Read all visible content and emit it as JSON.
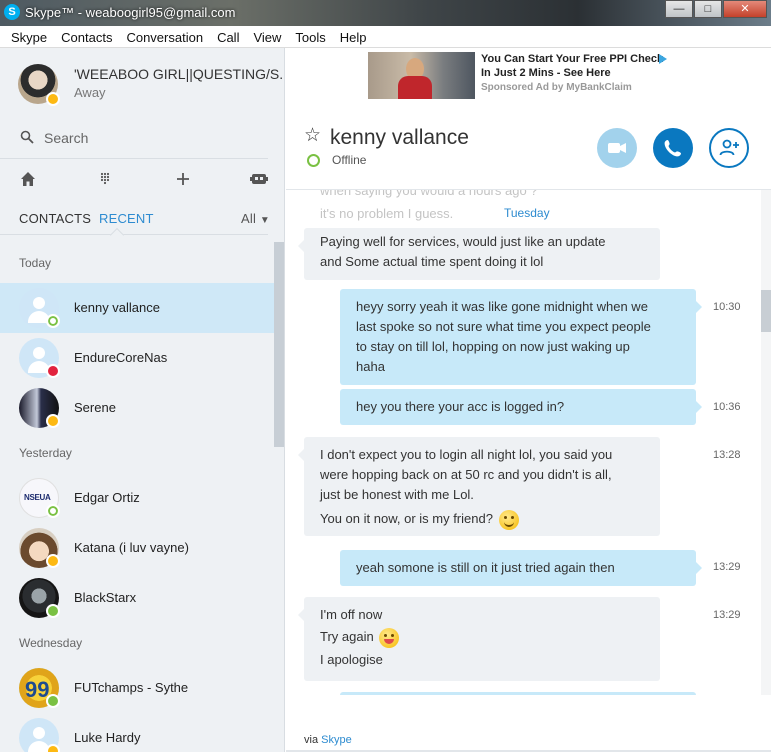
{
  "window": {
    "title": "Skype™ - weaboogirl95@gmail.com",
    "controls": [
      "minimize",
      "maximize",
      "close"
    ]
  },
  "menu": [
    "Skype",
    "Contacts",
    "Conversation",
    "Call",
    "View",
    "Tools",
    "Help"
  ],
  "profile": {
    "name": "'WEEABOO GIRL||QUESTING/S...",
    "status": "Away"
  },
  "search": {
    "placeholder": "Search"
  },
  "tabs": {
    "contacts": "CONTACTS",
    "recent": "RECENT",
    "filter": "All"
  },
  "sections": {
    "today": "Today",
    "yesterday": "Yesterday",
    "wednesday": "Wednesday"
  },
  "contacts": [
    {
      "name": "kenny vallance",
      "status": "offline",
      "active": true
    },
    {
      "name": "EndureCoreNas",
      "status": "dnd"
    },
    {
      "name": "Serene",
      "status": "away"
    },
    {
      "name": "Edgar Ortiz",
      "status": "offline"
    },
    {
      "name": "Katana (i luv vayne)",
      "status": "away"
    },
    {
      "name": "BlackStarx",
      "status": "online"
    },
    {
      "name": "FUTchamps - Sythe",
      "status": "online"
    },
    {
      "name": "Luke Hardy",
      "status": "away"
    }
  ],
  "ad": {
    "line1": "You Can Start Your Free PPI Check",
    "line2": "In Just 2 Mins - See Here",
    "sponsor": "Sponsored Ad by MyBankClaim"
  },
  "conversation": {
    "name": "kenny vallance",
    "status": "Offline",
    "day_divider": "Tuesday",
    "faded_lines": [
      "when saying you would a hours ago ?",
      "it's no problem I guess."
    ],
    "messages": [
      {
        "dir": "in",
        "lines": [
          "Paying well for services, would just like an update",
          "and Some actual time spent doing it lol"
        ],
        "time": ""
      },
      {
        "dir": "out",
        "lines": [
          "heyy sorry  yeah it was like gone midnight when we",
          "last spoke so not sure what time you expect people",
          "to stay on till lol, hopping on now just waking up",
          "haha"
        ],
        "time": "10:30"
      },
      {
        "dir": "out",
        "lines": [
          "hey you there your acc is logged in?"
        ],
        "time": "10:36"
      },
      {
        "dir": "in",
        "lines": [
          "I don't expect you to login all night lol, you said you",
          "were hopping back on at 50 rc and you didn't is all,",
          "just be honest with me Lol.",
          "You on it now, or is my friend?"
        ],
        "time": "13:28"
      },
      {
        "dir": "out",
        "lines": [
          "yeah somone is still on it just tried again then"
        ],
        "time": "13:29"
      },
      {
        "dir": "in",
        "lines": [
          "I'm off now",
          "Try again",
          "I apologise"
        ],
        "time": "13:29"
      }
    ]
  },
  "footer": {
    "via": "via",
    "link": "Skype"
  },
  "colors": {
    "accent": "#00aff0",
    "link": "#2d8bd0",
    "call_button": "#0a78c0",
    "outgoing_bubble": "#c7e9f9",
    "incoming_bubble": "#eef1f4"
  }
}
